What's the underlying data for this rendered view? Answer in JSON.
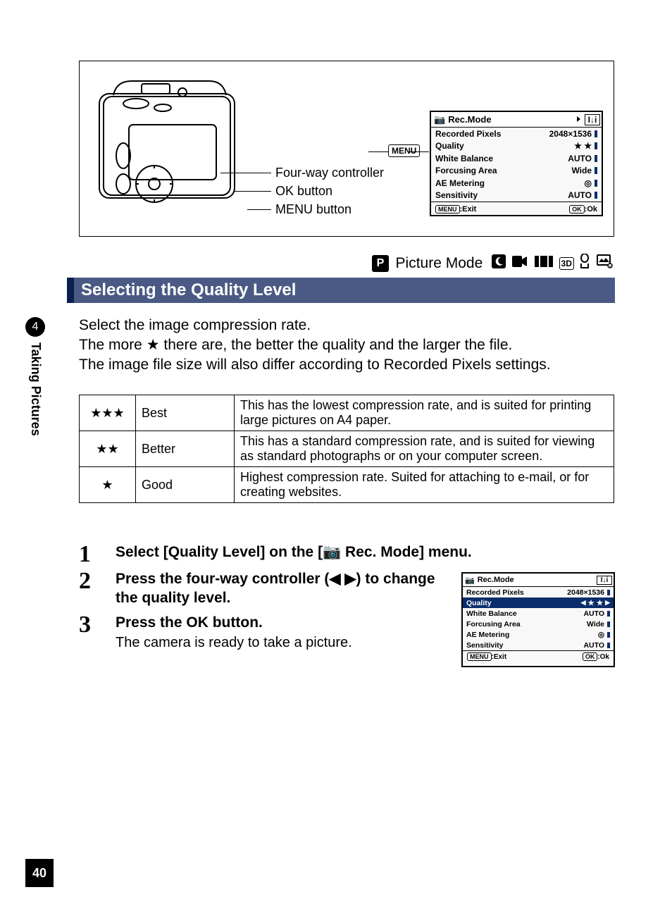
{
  "side": {
    "section_number": "4",
    "section_label": "Taking Pictures"
  },
  "figure": {
    "labels": {
      "four_way": "Four-way controller",
      "ok": "OK button",
      "menu": "MENU button"
    },
    "menu_tag": "MENU"
  },
  "screen": {
    "title_icon": "camera-icon",
    "title": "Rec.Mode",
    "page_indicator": "I↓i",
    "rows": [
      {
        "label": "Recorded Pixels",
        "value": "2048×1536"
      },
      {
        "label": "Quality",
        "value": "★ ★"
      },
      {
        "label": "White Balance",
        "value": "AUTO"
      },
      {
        "label": "Forcusing Area",
        "value": "Wide"
      },
      {
        "label": "AE Metering",
        "value": "◎"
      },
      {
        "label": "Sensitivity",
        "value": "AUTO"
      }
    ],
    "footer": {
      "left_key": "MENU",
      "left_text": ":Exit",
      "right_key": "OK",
      "right_text": ":Ok"
    }
  },
  "mode_row": {
    "p": "P",
    "label": "Picture Mode"
  },
  "heading": "Selecting the Quality Level",
  "intro": {
    "l1": "Select the image compression rate.",
    "l2a": "The more ",
    "l2b": " there are, the better the quality and the larger the file.",
    "l3": "The image file size will also differ according to Recorded Pixels settings."
  },
  "quality_table": [
    {
      "stars": "★★★",
      "name": "Best",
      "desc": "This has the lowest compression rate, and is suited for printing large pictures on A4 paper."
    },
    {
      "stars": "★★",
      "name": "Better",
      "desc": "This has a standard compression rate, and is suited for viewing as standard photographs or on your computer screen."
    },
    {
      "stars": "★",
      "name": "Good",
      "desc": "Highest compression rate. Suited for attaching to e-mail, or for creating websites."
    }
  ],
  "steps": [
    {
      "num": "1",
      "title_before": "Select [Quality Level] on the [",
      "title_after": " Rec. Mode] menu."
    },
    {
      "num": "2",
      "title": "Press the four-way controller (◀ ▶) to change the quality level."
    },
    {
      "num": "3",
      "title": "Press the OK button.",
      "text": "The camera is ready to take a picture."
    }
  ],
  "small_screen": {
    "title": "Rec.Mode",
    "page_indicator": "I↓i",
    "rows": [
      {
        "label": "Recorded Pixels",
        "value": "2048×1536"
      },
      {
        "label": "Quality",
        "value": "★ ★",
        "selected": true
      },
      {
        "label": "White Balance",
        "value": "AUTO"
      },
      {
        "label": "Forcusing Area",
        "value": "Wide"
      },
      {
        "label": "AE Metering",
        "value": "◎"
      },
      {
        "label": "Sensitivity",
        "value": "AUTO"
      }
    ],
    "footer": {
      "left_key": "MENU",
      "left_text": ":Exit",
      "right_key": "OK",
      "right_text": ":Ok"
    }
  },
  "page_number": "40"
}
